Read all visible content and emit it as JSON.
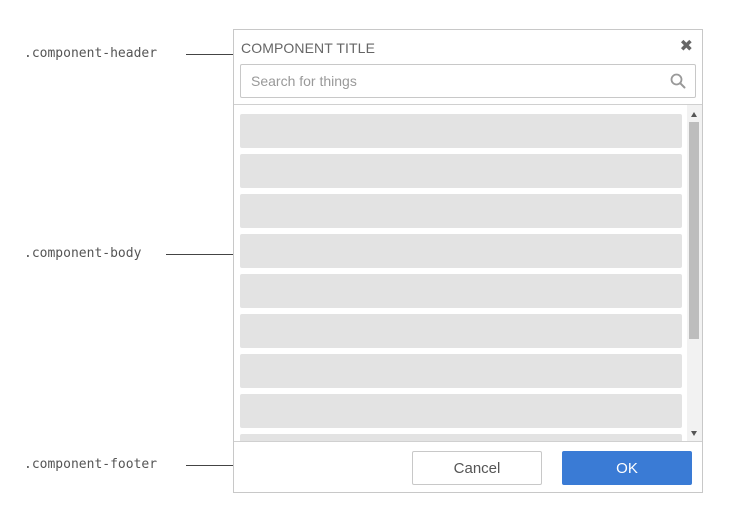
{
  "annotations": {
    "header": ".component-header",
    "body": ".component-body",
    "footer": ".component-footer"
  },
  "component": {
    "title": "COMPONENT TITLE",
    "close_icon": "close-icon",
    "search": {
      "placeholder": "Search for things",
      "value": "",
      "icon": "search-icon"
    },
    "list_row_count": 9,
    "footer": {
      "cancel_label": "Cancel",
      "ok_label": "OK"
    }
  },
  "colors": {
    "primary": "#3a7bd5",
    "row_placeholder": "#e3e3e3",
    "border": "#c8c8c8",
    "scroll_thumb": "#bdbdbd"
  }
}
